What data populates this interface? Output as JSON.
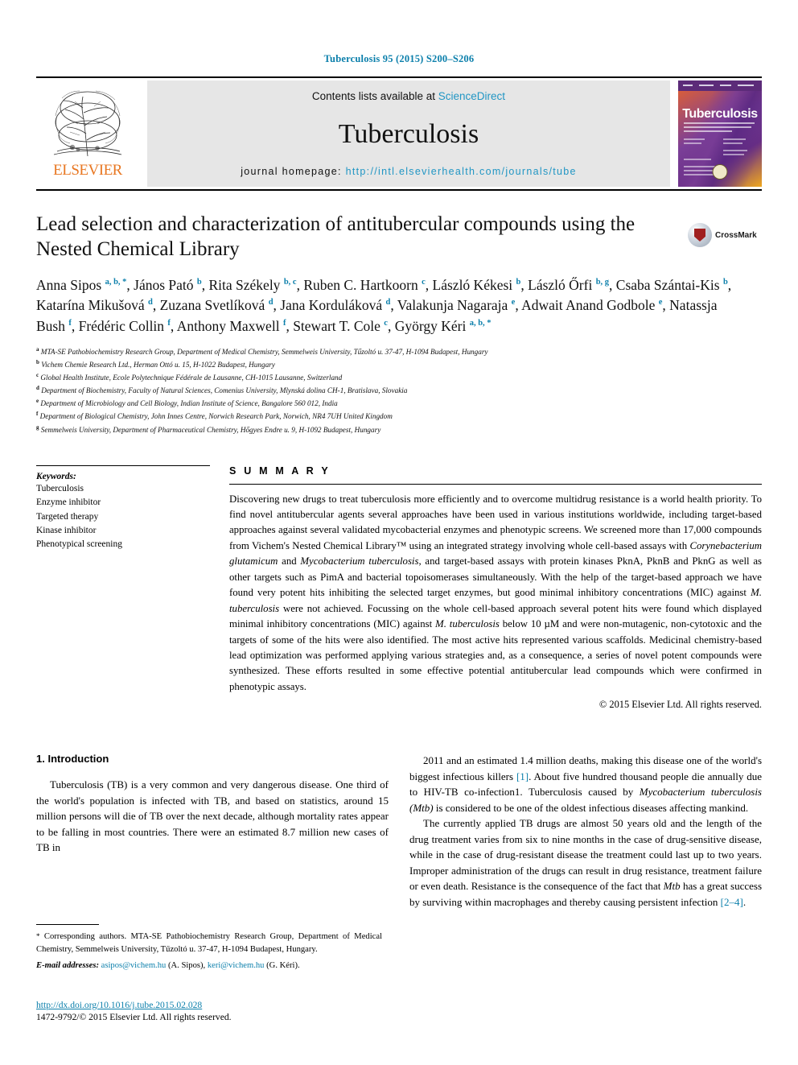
{
  "running_head": "Tuberculosis 95 (2015) S200–S206",
  "banner": {
    "publisher_logo_label": "ELSEVIER",
    "contents_prefix": "Contents lists available at",
    "contents_link": "ScienceDirect",
    "journal_name": "Tuberculosis",
    "homepage_prefix": "journal homepage:",
    "homepage_url": "http://intl.elsevierhealth.com/journals/tube",
    "cover_title": "Tuberculosis"
  },
  "crossmark": {
    "label": "CrossMark"
  },
  "article": {
    "title": "Lead selection and characterization of antitubercular compounds using the Nested Chemical Library",
    "authors": [
      {
        "name": "Anna Sipos",
        "marks": "a, b, *",
        "sep": ", "
      },
      {
        "name": "János Pató",
        "marks": "b",
        "sep": ", "
      },
      {
        "name": "Rita Székely",
        "marks": "b, c",
        "sep": ", "
      },
      {
        "name": "Ruben C. Hartkoorn",
        "marks": "c",
        "sep": ", "
      },
      {
        "name": "László Kékesi",
        "marks": "b",
        "sep": ", "
      },
      {
        "name": "László Őrfi",
        "marks": "b, g",
        "sep": ", "
      },
      {
        "name": "Csaba Szántai-Kis",
        "marks": "b",
        "sep": ", "
      },
      {
        "name": "Katarína Mikušová",
        "marks": "d",
        "sep": ", "
      },
      {
        "name": "Zuzana Svetlíková",
        "marks": "d",
        "sep": ", "
      },
      {
        "name": "Jana Korduláková",
        "marks": "d",
        "sep": ", "
      },
      {
        "name": "Valakunja Nagaraja",
        "marks": "e",
        "sep": ", "
      },
      {
        "name": "Adwait Anand Godbole",
        "marks": "e",
        "sep": ", "
      },
      {
        "name": "Natassja Bush",
        "marks": "f",
        "sep": ", "
      },
      {
        "name": "Frédéric Collin",
        "marks": "f",
        "sep": ", "
      },
      {
        "name": "Anthony Maxwell",
        "marks": "f",
        "sep": ", "
      },
      {
        "name": "Stewart T. Cole",
        "marks": "c",
        "sep": ", "
      },
      {
        "name": "György Kéri",
        "marks": "a, b, *",
        "sep": ""
      }
    ],
    "affiliations": [
      {
        "mark": "a",
        "text": "MTA-SE Pathobiochemistry Research Group, Department of Medical Chemistry, Semmelweis University, Tűzoltó u. 37-47, H-1094 Budapest, Hungary"
      },
      {
        "mark": "b",
        "text": "Vichem Chemie Research Ltd., Herman Ottó u. 15, H-1022 Budapest, Hungary"
      },
      {
        "mark": "c",
        "text": "Global Health Institute, Ecole Polytechnique Fédérale de Lausanne, CH-1015 Lausanne, Switzerland"
      },
      {
        "mark": "d",
        "text": "Department of Biochemistry, Faculty of Natural Sciences, Comenius University, Mlynská dolina CH-1, Bratislava, Slovakia"
      },
      {
        "mark": "e",
        "text": "Department of Microbiology and Cell Biology, Indian Institute of Science, Bangalore 560 012, India"
      },
      {
        "mark": "f",
        "text": "Department of Biological Chemistry, John Innes Centre, Norwich Research Park, Norwich, NR4 7UH United Kingdom"
      },
      {
        "mark": "g",
        "text": "Semmelweis University, Department of Pharmaceutical Chemistry, Hőgyes Endre u. 9, H-1092 Budapest, Hungary"
      }
    ]
  },
  "keywords": {
    "heading": "Keywords:",
    "items": [
      "Tuberculosis",
      "Enzyme inhibitor",
      "Targeted therapy",
      "Kinase inhibitor",
      "Phenotypical screening"
    ]
  },
  "summary": {
    "heading": "S U M M A R Y",
    "paragraph_html": "Discovering new drugs to treat tuberculosis more efficiently and to overcome multidrug resistance is a world health priority. To find novel antitubercular agents several approaches have been used in various institutions worldwide, including target-based approaches against several validated mycobacterial enzymes and phenotypic screens. We screened more than 17,000 compounds from Vichem's Nested Chemical Library™ using an integrated strategy involving whole cell-based assays with <i>Corynebacterium glutamicum</i> and <i>Mycobacterium tuberculosis</i>, and target-based assays with protein kinases PknA, PknB and PknG as well as other targets such as PimA and bacterial topoisomerases simultaneously. With the help of the target-based approach we have found very potent hits inhibiting the selected target enzymes, but good minimal inhibitory concentrations (MIC) against <i>M. tuberculosis</i> were not achieved. Focussing on the whole cell-based approach several potent hits were found which displayed minimal inhibitory concentrations (MIC) against <i>M. tuberculosis</i> below 10 µM and were non-mutagenic, non-cytotoxic and the targets of some of the hits were also identified. The most active hits represented various scaffolds. Medicinal chemistry-based lead optimization was performed applying various strategies and, as a consequence, a series of novel potent compounds were synthesized. These efforts resulted in some effective potential antitubercular lead compounds which were confirmed in phenotypic assays.",
    "copyright": "© 2015 Elsevier Ltd. All rights reserved."
  },
  "body": {
    "section_number_title": "1. Introduction",
    "left_paragraph_html": "Tuberculosis (TB) is a very common and very dangerous disease. One third of the world's population is infected with TB, and based on statistics, around 15 million persons will die of TB over the next decade, although mortality rates appear to be falling in most countries. There were an estimated 8.7 million new cases of TB in",
    "right_paragraph_1_html": "2011 and an estimated 1.4 million deaths, making this disease one of the world's biggest infectious killers <span class=\"ref\">[1]</span>. About five hundred thousand people die annually due to HIV-TB co-infection1. Tuberculosis caused by <i>Mycobacterium tuberculosis (Mtb)</i> is considered to be one of the oldest infectious diseases affecting mankind.",
    "right_paragraph_2_html": "The currently applied TB drugs are almost 50 years old and the length of the drug treatment varies from six to nine months in the case of drug-sensitive disease, while in the case of drug-resistant disease the treatment could last up to two years. Improper administration of the drugs can result in drug resistance, treatment failure or even death. Resistance is the consequence of the fact that <i>Mtb</i> has a great success by surviving within macrophages and thereby causing persistent infection <span class=\"ref\">[2–4]</span>."
  },
  "footnotes": {
    "corresponding_html": "<span class=\"star\">*</span> Corresponding authors. MTA-SE Pathobiochemistry Research Group, Department of Medical Chemistry, Semmelweis University, Tűzoltó u. 37-47, H-1094 Budapest, Hungary.",
    "email_label": "E-mail addresses:",
    "email_1": "asipos@vichem.hu",
    "email_1_owner": "(A. Sipos),",
    "email_2": "keri@vichem.hu",
    "email_2_owner": "(G. Kéri)."
  },
  "doi": {
    "url": "http://dx.doi.org/10.1016/j.tube.2015.02.028",
    "issn_line": "1472-9792/© 2015 Elsevier Ltd. All rights reserved."
  },
  "colors": {
    "link_blue": "#0b7fab",
    "banner_grey": "#e6e6e6",
    "elsevier_orange": "#e87722"
  }
}
